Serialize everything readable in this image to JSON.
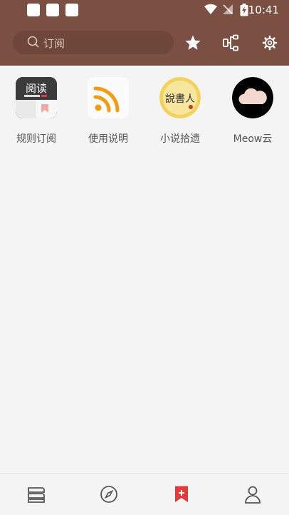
{
  "status_bar": {
    "time": "10:41"
  },
  "search": {
    "placeholder": "订阅"
  },
  "toolbar": {
    "star": "star-icon",
    "group": "group-icon",
    "settings": "gear-icon"
  },
  "sources": [
    {
      "name": "规则订阅",
      "icon": "read-book-icon",
      "icon_text": "阅读"
    },
    {
      "name": "使用说明",
      "icon": "rss-icon"
    },
    {
      "name": "小说拾遗",
      "icon": "story-teller-icon",
      "icon_text": "說書人"
    },
    {
      "name": "Meow云",
      "icon": "cloud-icon"
    }
  ],
  "nav": [
    "bookshelf-icon",
    "explore-icon",
    "rss-subscribe-icon",
    "my-icon"
  ],
  "colors": {
    "header": "#7b4f42",
    "accent": "#e23b3b",
    "background": "#f4f4f4"
  }
}
